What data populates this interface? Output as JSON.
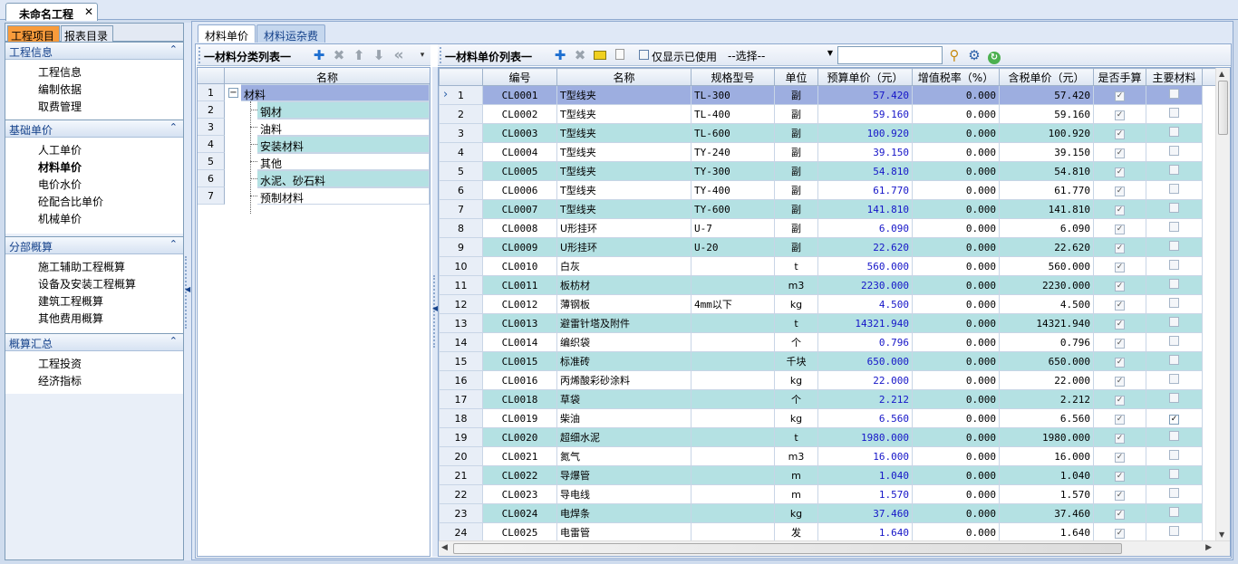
{
  "doc_tab": {
    "title": "未命名工程",
    "close": "✕"
  },
  "left": {
    "tabs": [
      "工程项目",
      "报表目录"
    ],
    "sections": [
      {
        "title": "工程信息",
        "items": [
          "工程信息",
          "编制依据",
          "取费管理"
        ]
      },
      {
        "title": "基础单价",
        "items": [
          "人工单价",
          "材料单价",
          "电价水价",
          "砼配合比单价",
          "机械单价"
        ],
        "selected": "材料单价"
      },
      {
        "title": "分部概算",
        "items": [
          "施工辅助工程概算",
          "设备及安装工程概算",
          "建筑工程概算",
          "其他费用概算"
        ]
      },
      {
        "title": "概算汇总",
        "items": [
          "工程投资",
          "经济指标"
        ]
      }
    ]
  },
  "main_tabs": [
    "材料单价",
    "材料运杂费"
  ],
  "cat_toolbar": {
    "title": "一材料分类列表一"
  },
  "cat_table": {
    "header": "名称",
    "rows": [
      {
        "n": "1",
        "name": "材料"
      },
      {
        "n": "2",
        "name": "钢材"
      },
      {
        "n": "3",
        "name": "油料"
      },
      {
        "n": "4",
        "name": "安装材料"
      },
      {
        "n": "5",
        "name": "其他"
      },
      {
        "n": "6",
        "name": "水泥、砂石料"
      },
      {
        "n": "7",
        "name": "预制材料"
      }
    ]
  },
  "grid_toolbar": {
    "title": "一材料单价列表一",
    "only_used_label": "仅显示已使用",
    "select_value": "--选择--",
    "search_value": ""
  },
  "grid": {
    "headers": [
      "编号",
      "名称",
      "规格型号",
      "单位",
      "预算单价（元）",
      "增值税率（%）",
      "含税单价（元）",
      "是否手算",
      "主要材料"
    ],
    "rows": [
      [
        "1",
        "CL0001",
        "T型线夹",
        "TL-300",
        "副",
        "57.420",
        "0.000",
        "57.420",
        true,
        false
      ],
      [
        "2",
        "CL0002",
        "T型线夹",
        "TL-400",
        "副",
        "59.160",
        "0.000",
        "59.160",
        true,
        false
      ],
      [
        "3",
        "CL0003",
        "T型线夹",
        "TL-600",
        "副",
        "100.920",
        "0.000",
        "100.920",
        true,
        false
      ],
      [
        "4",
        "CL0004",
        "T型线夹",
        "TY-240",
        "副",
        "39.150",
        "0.000",
        "39.150",
        true,
        false
      ],
      [
        "5",
        "CL0005",
        "T型线夹",
        "TY-300",
        "副",
        "54.810",
        "0.000",
        "54.810",
        true,
        false
      ],
      [
        "6",
        "CL0006",
        "T型线夹",
        "TY-400",
        "副",
        "61.770",
        "0.000",
        "61.770",
        true,
        false
      ],
      [
        "7",
        "CL0007",
        "T型线夹",
        "TY-600",
        "副",
        "141.810",
        "0.000",
        "141.810",
        true,
        false
      ],
      [
        "8",
        "CL0008",
        "U形挂环",
        "U-7",
        "副",
        "6.090",
        "0.000",
        "6.090",
        true,
        false
      ],
      [
        "9",
        "CL0009",
        "U形挂环",
        "U-20",
        "副",
        "22.620",
        "0.000",
        "22.620",
        true,
        false
      ],
      [
        "10",
        "CL0010",
        "白灰",
        "",
        "t",
        "560.000",
        "0.000",
        "560.000",
        true,
        false
      ],
      [
        "11",
        "CL0011",
        "板枋材",
        "",
        "m3",
        "2230.000",
        "0.000",
        "2230.000",
        true,
        false
      ],
      [
        "12",
        "CL0012",
        "薄钢板",
        "4mm以下",
        "kg",
        "4.500",
        "0.000",
        "4.500",
        true,
        false
      ],
      [
        "13",
        "CL0013",
        "避雷针塔及附件",
        "",
        "t",
        "14321.940",
        "0.000",
        "14321.940",
        true,
        false
      ],
      [
        "14",
        "CL0014",
        "编织袋",
        "",
        "个",
        "0.796",
        "0.000",
        "0.796",
        true,
        false
      ],
      [
        "15",
        "CL0015",
        "标准砖",
        "",
        "千块",
        "650.000",
        "0.000",
        "650.000",
        true,
        false
      ],
      [
        "16",
        "CL0016",
        "丙烯酸彩砂涂料",
        "",
        "kg",
        "22.000",
        "0.000",
        "22.000",
        true,
        false
      ],
      [
        "17",
        "CL0018",
        "草袋",
        "",
        "个",
        "2.212",
        "0.000",
        "2.212",
        true,
        false
      ],
      [
        "18",
        "CL0019",
        "柴油",
        "",
        "kg",
        "6.560",
        "0.000",
        "6.560",
        true,
        true
      ],
      [
        "19",
        "CL0020",
        "超细水泥",
        "",
        "t",
        "1980.000",
        "0.000",
        "1980.000",
        true,
        false
      ],
      [
        "20",
        "CL0021",
        "氮气",
        "",
        "m3",
        "16.000",
        "0.000",
        "16.000",
        true,
        false
      ],
      [
        "21",
        "CL0022",
        "导爆管",
        "",
        "m",
        "1.040",
        "0.000",
        "1.040",
        true,
        false
      ],
      [
        "22",
        "CL0023",
        "导电线",
        "",
        "m",
        "1.570",
        "0.000",
        "1.570",
        true,
        false
      ],
      [
        "23",
        "CL0024",
        "电焊条",
        "",
        "kg",
        "37.460",
        "0.000",
        "37.460",
        true,
        false
      ],
      [
        "24",
        "CL0025",
        "电雷管",
        "",
        "发",
        "1.640",
        "0.000",
        "1.640",
        true,
        false
      ]
    ]
  },
  "colors": {
    "accent_tab": "#f89b3b",
    "selected_row": "#9daee0",
    "teal_row": "#b4e1e3",
    "price_text": "#1515c8"
  }
}
